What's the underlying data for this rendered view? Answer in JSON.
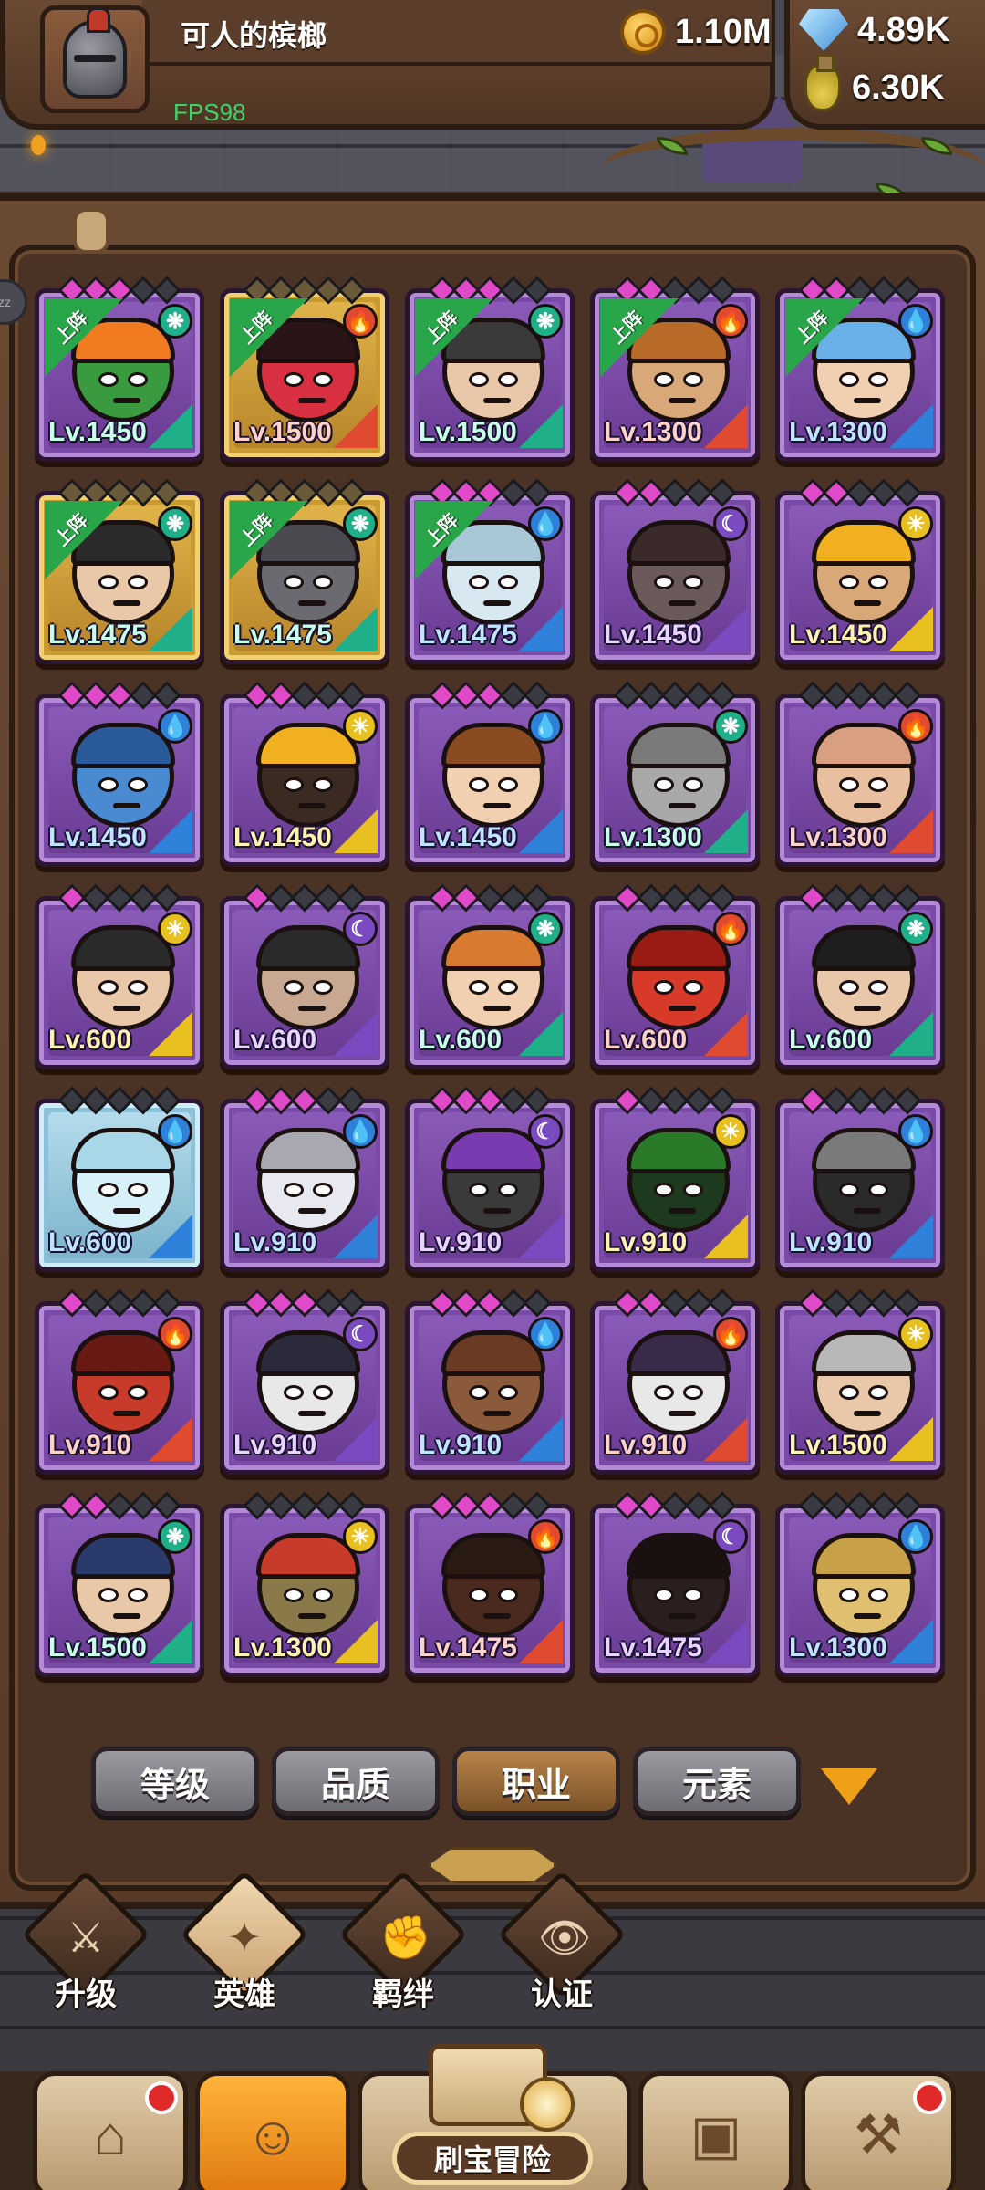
{
  "player": {
    "name": "可人的槟榔",
    "fps": "FPS98"
  },
  "resources": {
    "gold": "1.10M",
    "gems": "4.89K",
    "potions": "6.30K"
  },
  "deployed_label": "上阵",
  "heroes": [
    {
      "level": "Lv.1450",
      "element": "wind",
      "stars": [
        1,
        1,
        1,
        0,
        0
      ],
      "deployed": true,
      "frame": "purple",
      "skin": "#3a9a40",
      "hair": "#f07a20"
    },
    {
      "level": "Lv.1500",
      "element": "fire",
      "stars": [
        0,
        0,
        0,
        0,
        0
      ],
      "deployed": true,
      "frame": "gold",
      "skin": "#d83040",
      "hair": "#2a1418"
    },
    {
      "level": "Lv.1500",
      "element": "wind",
      "stars": [
        1,
        1,
        1,
        0,
        0
      ],
      "deployed": true,
      "frame": "purple",
      "skin": "#e8c8a8",
      "hair": "#3a3a3a"
    },
    {
      "level": "Lv.1300",
      "element": "fire",
      "stars": [
        1,
        1,
        0,
        0,
        0
      ],
      "deployed": true,
      "frame": "purple",
      "skin": "#d8a878",
      "hair": "#b86a28"
    },
    {
      "level": "Lv.1300",
      "element": "water",
      "stars": [
        1,
        1,
        0,
        0,
        0
      ],
      "deployed": true,
      "frame": "purple",
      "skin": "#f0d0b0",
      "hair": "#6ab0e8"
    },
    {
      "level": "Lv.1475",
      "element": "wind",
      "stars": [
        0,
        0,
        0,
        0,
        0
      ],
      "deployed": true,
      "frame": "gold",
      "skin": "#e8c8a8",
      "hair": "#2a2a2a"
    },
    {
      "level": "Lv.1475",
      "element": "wind",
      "stars": [
        0,
        0,
        0,
        0,
        0
      ],
      "deployed": true,
      "frame": "gold",
      "skin": "#6a6a70",
      "hair": "#4a4a50"
    },
    {
      "level": "Lv.1475",
      "element": "water",
      "stars": [
        1,
        1,
        1,
        0,
        0
      ],
      "deployed": true,
      "frame": "purple",
      "skin": "#d8e8f0",
      "hair": "#a8c8d8"
    },
    {
      "level": "Lv.1450",
      "element": "dark",
      "stars": [
        1,
        1,
        0,
        0,
        0
      ],
      "deployed": false,
      "frame": "purple",
      "skin": "#6a5a5a",
      "hair": "#3a2a2a"
    },
    {
      "level": "Lv.1450",
      "element": "light",
      "stars": [
        1,
        1,
        0,
        0,
        0
      ],
      "deployed": false,
      "frame": "purple",
      "skin": "#d8a878",
      "hair": "#f0b020"
    },
    {
      "level": "Lv.1450",
      "element": "water",
      "stars": [
        1,
        1,
        1,
        0,
        0
      ],
      "deployed": false,
      "frame": "purple",
      "skin": "#4a8ad0",
      "hair": "#2a5a9a"
    },
    {
      "level": "Lv.1450",
      "element": "light",
      "stars": [
        1,
        1,
        0,
        0,
        0
      ],
      "deployed": false,
      "frame": "purple",
      "skin": "#3a2a22",
      "hair": "#f0b020"
    },
    {
      "level": "Lv.1450",
      "element": "water",
      "stars": [
        1,
        1,
        1,
        0,
        0
      ],
      "deployed": false,
      "frame": "purple",
      "skin": "#f0d0b0",
      "hair": "#8a4a22"
    },
    {
      "level": "Lv.1300",
      "element": "wind",
      "stars": [
        0,
        0,
        0,
        0,
        0
      ],
      "deployed": false,
      "frame": "purple",
      "skin": "#a8a8a8",
      "hair": "#7a7a7a"
    },
    {
      "level": "Lv.1300",
      "element": "fire",
      "stars": [
        0,
        0,
        0,
        0,
        0
      ],
      "deployed": false,
      "frame": "purple",
      "skin": "#e8c0a0",
      "hair": "#d8a080"
    },
    {
      "level": "Lv.600",
      "element": "light",
      "stars": [
        1,
        0,
        0,
        0,
        0
      ],
      "deployed": false,
      "frame": "purple",
      "skin": "#e8c8a8",
      "hair": "#2a2a2a"
    },
    {
      "level": "Lv.600",
      "element": "dark",
      "stars": [
        1,
        0,
        0,
        0,
        0
      ],
      "deployed": false,
      "frame": "purple",
      "skin": "#c8a890",
      "hair": "#2a2a2a"
    },
    {
      "level": "Lv.600",
      "element": "wind",
      "stars": [
        1,
        1,
        0,
        0,
        0
      ],
      "deployed": false,
      "frame": "purple",
      "skin": "#f0d0b0",
      "hair": "#d87a30"
    },
    {
      "level": "Lv.600",
      "element": "fire",
      "stars": [
        1,
        0,
        0,
        0,
        0
      ],
      "deployed": false,
      "frame": "purple",
      "skin": "#d83a2a",
      "hair": "#9a1a14"
    },
    {
      "level": "Lv.600",
      "element": "wind",
      "stars": [
        1,
        0,
        0,
        0,
        0
      ],
      "deployed": false,
      "frame": "purple",
      "skin": "#e8c8a8",
      "hair": "#1e1e1e"
    },
    {
      "level": "Lv.600",
      "element": "water",
      "stars": [
        0,
        0,
        0,
        0,
        0
      ],
      "deployed": false,
      "frame": "frost",
      "skin": "#d8f0f8",
      "hair": "#a8d8e8"
    },
    {
      "level": "Lv.910",
      "element": "water",
      "stars": [
        1,
        1,
        1,
        0,
        0
      ],
      "deployed": false,
      "frame": "purple",
      "skin": "#e8e8f0",
      "hair": "#a8a8b0"
    },
    {
      "level": "Lv.910",
      "element": "dark",
      "stars": [
        1,
        1,
        1,
        0,
        0
      ],
      "deployed": false,
      "frame": "purple",
      "skin": "#3a3a3a",
      "hair": "#7a3ab0"
    },
    {
      "level": "Lv.910",
      "element": "light",
      "stars": [
        1,
        0,
        0,
        0,
        0
      ],
      "deployed": false,
      "frame": "purple",
      "skin": "#1e3a1e",
      "hair": "#2a7a2a"
    },
    {
      "level": "Lv.910",
      "element": "water",
      "stars": [
        1,
        0,
        0,
        0,
        0
      ],
      "deployed": false,
      "frame": "purple",
      "skin": "#2a2a2a",
      "hair": "#7a7a7a"
    },
    {
      "level": "Lv.910",
      "element": "fire",
      "stars": [
        1,
        0,
        0,
        0,
        0
      ],
      "deployed": false,
      "frame": "purple",
      "skin": "#c83a2a",
      "hair": "#6a1a14"
    },
    {
      "level": "Lv.910",
      "element": "dark",
      "stars": [
        1,
        1,
        1,
        0,
        0
      ],
      "deployed": false,
      "frame": "purple",
      "skin": "#e8e8e8",
      "hair": "#2a2a3a"
    },
    {
      "level": "Lv.910",
      "element": "water",
      "stars": [
        1,
        1,
        1,
        0,
        0
      ],
      "deployed": false,
      "frame": "purple",
      "skin": "#8a5a3a",
      "hair": "#6a3a22"
    },
    {
      "level": "Lv.910",
      "element": "fire",
      "stars": [
        1,
        1,
        0,
        0,
        0
      ],
      "deployed": false,
      "frame": "purple",
      "skin": "#e8e8e8",
      "hair": "#3a2a4a"
    },
    {
      "level": "Lv.1500",
      "element": "light",
      "stars": [
        1,
        0,
        0,
        0,
        0
      ],
      "deployed": false,
      "frame": "purple",
      "skin": "#e8c8a8",
      "hair": "#b8b8b8"
    },
    {
      "level": "Lv.1500",
      "element": "wind",
      "stars": [
        1,
        1,
        0,
        0,
        0
      ],
      "deployed": false,
      "frame": "purple",
      "skin": "#e8c8a8",
      "hair": "#2a3a6a"
    },
    {
      "level": "Lv.1300",
      "element": "light",
      "stars": [
        0,
        0,
        0,
        0,
        0
      ],
      "deployed": false,
      "frame": "purple",
      "skin": "#8a7a4a",
      "hair": "#c83a2a"
    },
    {
      "level": "Lv.1475",
      "element": "fire",
      "stars": [
        1,
        1,
        1,
        0,
        0
      ],
      "deployed": false,
      "frame": "purple",
      "skin": "#4a2a1e",
      "hair": "#2a1a14"
    },
    {
      "level": "Lv.1475",
      "element": "dark",
      "stars": [
        1,
        1,
        0,
        0,
        0
      ],
      "deployed": false,
      "frame": "purple",
      "skin": "#2a1e1e",
      "hair": "#1a1010"
    },
    {
      "level": "Lv.1300",
      "element": "water",
      "stars": [
        0,
        0,
        0,
        0,
        0
      ],
      "deployed": false,
      "frame": "purple",
      "skin": "#e0c070",
      "hair": "#c8a048"
    }
  ],
  "element_icons": {
    "water": "💧",
    "fire": "🔥",
    "wind": "❋",
    "light": "☀",
    "dark": "☾"
  },
  "filter_tabs": [
    {
      "label": "等级",
      "active": false
    },
    {
      "label": "品质",
      "active": false
    },
    {
      "label": "职业",
      "active": true
    },
    {
      "label": "元素",
      "active": false
    }
  ],
  "subnav": [
    {
      "label": "升级",
      "icon": "⚔",
      "name": "upgrade"
    },
    {
      "label": "英雄",
      "icon": "✦",
      "name": "heroes",
      "active": true
    },
    {
      "label": "羁绊",
      "icon": "✊",
      "name": "bond"
    },
    {
      "label": "认证",
      "icon": "👁",
      "name": "certify"
    }
  ],
  "mainnav": {
    "adventure_label": "刷宝冒险"
  }
}
